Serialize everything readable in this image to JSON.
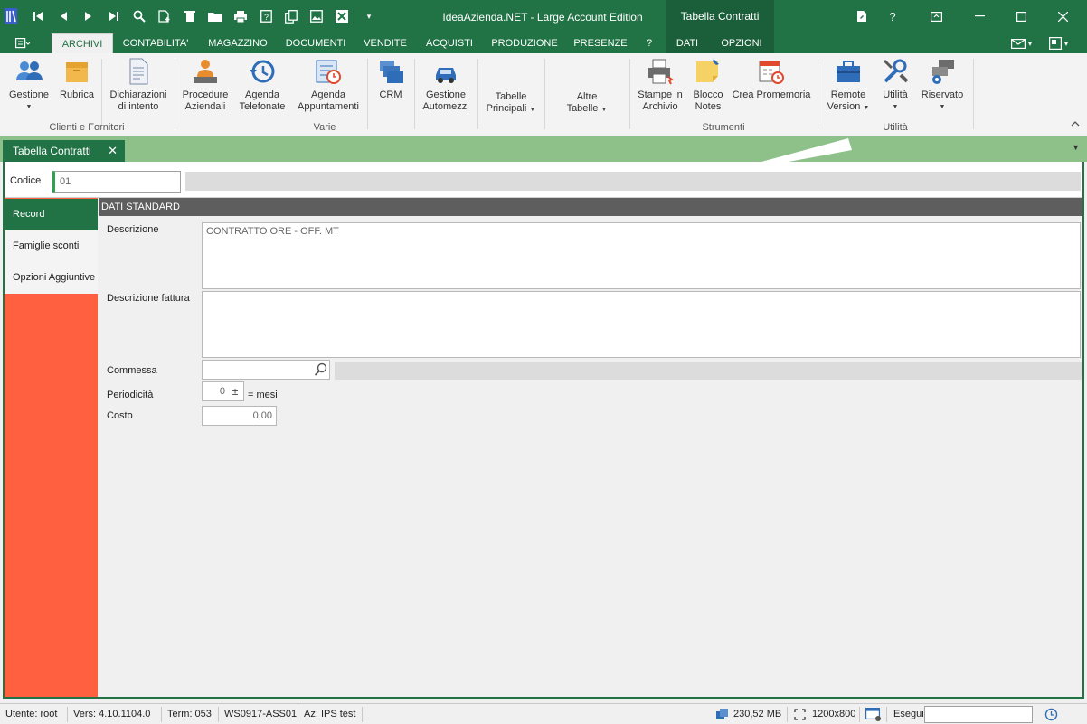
{
  "titlebar": {
    "app_title": "IdeaAzienda.NET - Large Account Edition",
    "context_title": "Tabella Contratti",
    "help_label": "?"
  },
  "ribbon_tabs": {
    "items": [
      {
        "label": "ARCHIVI",
        "active": true
      },
      {
        "label": "CONTABILITA'"
      },
      {
        "label": "MAGAZZINO"
      },
      {
        "label": "DOCUMENTI"
      },
      {
        "label": "VENDITE"
      },
      {
        "label": "ACQUISTI"
      },
      {
        "label": "PRODUZIONE"
      },
      {
        "label": "PRESENZE"
      },
      {
        "label": "?"
      },
      {
        "label": "DATI"
      },
      {
        "label": "OPZIONI"
      }
    ]
  },
  "ribbon": {
    "buttons": {
      "gestione": "Gestione",
      "rubrica": "Rubrica",
      "dichiarazioni_1": "Dichiarazioni",
      "dichiarazioni_2": "di intento",
      "procedure_1": "Procedure",
      "procedure_2": "Aziendali",
      "agenda_tel_1": "Agenda",
      "agenda_tel_2": "Telefonate",
      "agenda_app_1": "Agenda",
      "agenda_app_2": "Appuntamenti",
      "crm": "CRM",
      "automezzi_1": "Gestione",
      "automezzi_2": "Automezzi",
      "tabelle_1": "Tabelle",
      "tabelle_2": "Principali",
      "altre_1": "Altre",
      "altre_2": "Tabelle",
      "stampe_1": "Stampe in",
      "stampe_2": "Archivio",
      "blocco_1": "Blocco",
      "blocco_2": "Notes",
      "promemoria": "Crea Promemoria",
      "remote_1": "Remote",
      "remote_2": "Version",
      "utilita": "Utilità",
      "riservato": "Riservato"
    },
    "groups": {
      "clienti": "Clienti e Fornitori",
      "varie": "Varie",
      "strumenti": "Strumenti",
      "utilita": "Utilità"
    }
  },
  "doc_tab": {
    "label": "Tabella Contratti"
  },
  "form": {
    "codice_label": "Codice",
    "codice_value": "01",
    "section_title": "DATI STANDARD",
    "descrizione_label": "Descrizione",
    "descrizione_value": "CONTRATTO ORE - OFF. MT",
    "descr_fattura_label": "Descrizione fattura",
    "descr_fattura_value": "",
    "commessa_label": "Commessa",
    "commessa_value": "",
    "periodicita_label": "Periodicità",
    "periodicita_value": "0",
    "periodicita_suffix": "= mesi",
    "costo_label": "Costo",
    "costo_value": "0,00"
  },
  "sidebar": {
    "items": [
      {
        "label": "Record",
        "active": true
      },
      {
        "label": "Famiglie sconti"
      },
      {
        "label": "Opzioni Aggiuntive"
      }
    ]
  },
  "statusbar": {
    "utente": "Utente: root",
    "versione": "Vers: 4.10.1104.0",
    "term": "Term: 053",
    "workstation": "WS0917-ASS01",
    "azienda": "Az: IPS test",
    "memoria": "230,52 MB",
    "risoluzione": "1200x800",
    "esegui_label": "Esegui",
    "esegui_value": ""
  },
  "colors": {
    "brand_green": "#217346",
    "sidebar_orange": "#fe6040",
    "strip_green": "#8ec18a",
    "section_header": "#5e5e5e"
  }
}
